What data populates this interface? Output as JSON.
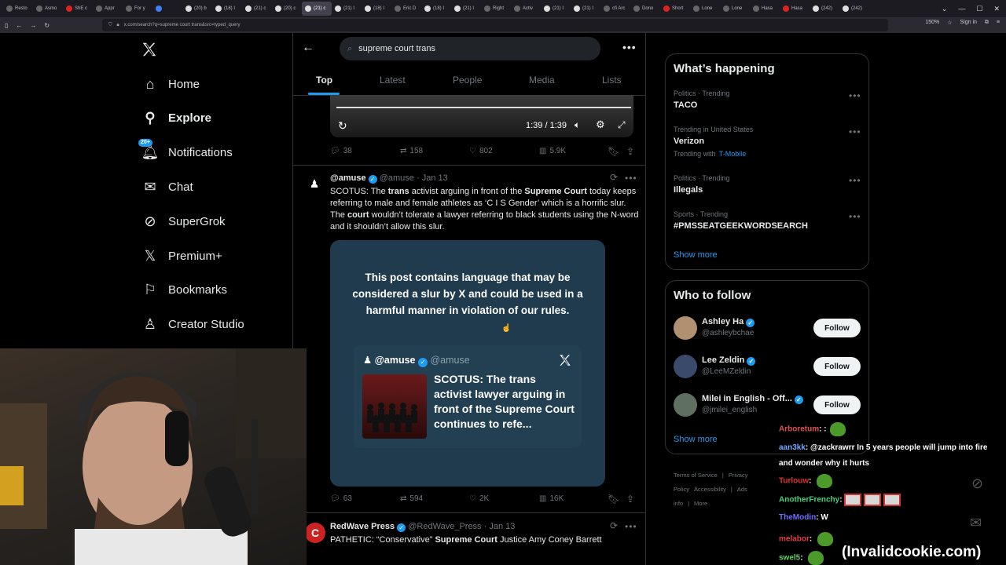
{
  "browser": {
    "tabs": [
      "Resto",
      "Asmo",
      "ShE c",
      "Appr",
      "For y",
      "",
      "(20) b",
      "(18) I",
      "(21) c",
      "(20) c",
      "(21) c",
      "(21) I",
      "(18) I",
      "Eric D",
      "(18) I",
      "(21) I",
      "Right",
      "Activ",
      "(21) I",
      "(21) I",
      "cfi Arc",
      "Dono",
      "Short",
      "Lone",
      "Lone",
      "Hasa",
      "Hasa",
      "(242)",
      "(242)"
    ],
    "active_tab_index": 10,
    "url": "x.com/search?q=supreme court trans&src=typed_query",
    "zoom": "150%",
    "signin": "Sign in"
  },
  "sidebar": {
    "items": [
      {
        "label": "Home",
        "icon": "home-icon"
      },
      {
        "label": "Explore",
        "icon": "search-icon",
        "active": true
      },
      {
        "label": "Notifications",
        "icon": "bell-icon",
        "badge": "20+"
      },
      {
        "label": "Chat",
        "icon": "mail-icon"
      },
      {
        "label": "SuperGrok",
        "icon": "grok-icon"
      },
      {
        "label": "Premium+",
        "icon": "x-logo-icon"
      },
      {
        "label": "Bookmarks",
        "icon": "bookmark-icon"
      },
      {
        "label": "Creator Studio",
        "icon": "creator-icon"
      }
    ]
  },
  "search": {
    "query": "supreme court trans",
    "tabs": [
      "Top",
      "Latest",
      "People",
      "Media",
      "Lists"
    ]
  },
  "video": {
    "time": "1:39 / 1:39",
    "stats": {
      "replies": "38",
      "reposts": "158",
      "likes": "802",
      "views": "5.9K"
    }
  },
  "tweet1": {
    "name": "@amuse",
    "handle": "@amuse",
    "date": "Jan 13",
    "text_parts": [
      {
        "t": "SCOTUS: The ",
        "b": false
      },
      {
        "t": "trans",
        "b": true
      },
      {
        "t": " activist arguing in front of the ",
        "b": false
      },
      {
        "t": "Supreme Court",
        "b": true
      },
      {
        "t": " today keeps referring to male and female athletes as ‘C I S Gender’ which is a horrific slur. The ",
        "b": false
      },
      {
        "t": "court",
        "b": true
      },
      {
        "t": " wouldn’t tolerate a lawyer referring to black students using the N-word and it shouldn’t allow this slur.",
        "b": false
      }
    ],
    "card_warning": "This post contains language that may be considered a slur by X and could be used in a harmful manner in violation of our rules.",
    "embedded": {
      "name": "@amuse",
      "handle": "@amuse",
      "text": "SCOTUS: The trans activist lawyer arguing in front of the Supreme Court continues to refe..."
    },
    "stats": {
      "replies": "63",
      "reposts": "594",
      "likes": "2K",
      "views": "16K"
    }
  },
  "tweet2": {
    "name": "RedWave Press",
    "handle": "@RedWave_Press",
    "date": "Jan 13",
    "text_parts": [
      {
        "t": "PATHETIC: “Conservative” ",
        "b": false
      },
      {
        "t": "Supreme Court",
        "b": true
      },
      {
        "t": " Justice Amy Coney Barrett",
        "b": false
      }
    ]
  },
  "whats_happening": {
    "title": "What’s happening",
    "trends": [
      {
        "meta": "Politics · Trending",
        "name": "TACO"
      },
      {
        "meta": "Trending in United States",
        "name": "Verizon",
        "sub": "Trending with",
        "sub_link": "T-Mobile"
      },
      {
        "meta": "Politics · Trending",
        "name": "Illegals"
      },
      {
        "meta": "Sports · Trending",
        "name": "#PMSSEATGEEKWORDSEARCH"
      }
    ],
    "show_more": "Show more"
  },
  "who_to_follow": {
    "title": "Who to follow",
    "users": [
      {
        "name": "Ashley Ha",
        "handle": "@ashleybchae",
        "button": "Follow"
      },
      {
        "name": "Lee Zeldin",
        "handle": "@LeeMZeldin",
        "button": "Follow"
      },
      {
        "name": "Milei in English - Off...",
        "handle": "@jmilei_english",
        "button": "Follow"
      }
    ],
    "show_more": "Show more"
  },
  "footer_links": [
    "Terms of Service",
    "|",
    "Privacy Policy",
    "Accessibility",
    "|",
    "Ads info",
    "|",
    "More"
  ],
  "chat": [
    {
      "user": "Arboretum",
      "color": "#e05050",
      "msg": ":",
      "emote": 1
    },
    {
      "user": "aan3kk",
      "color": "#6fa8ff",
      "msg": "@zackrawrr In 5 years people will jump into fire and wonder why it hurts"
    },
    {
      "user": "Turlouw",
      "color": "#e03030",
      "msg": "",
      "emote": 1
    },
    {
      "user": "AnotherFrenchy",
      "color": "#43d17a",
      "msg": "",
      "emote2": 3
    },
    {
      "user": "TheModin",
      "color": "#6f6fff",
      "msg": "W"
    },
    {
      "user": "melabor",
      "color": "#e04040",
      "msg": "",
      "emote": 1
    },
    {
      "user": "swel5",
      "color": "#5fd15f",
      "msg": "",
      "emote": 1
    }
  ],
  "watermark": "(Invalidcookie.com)"
}
